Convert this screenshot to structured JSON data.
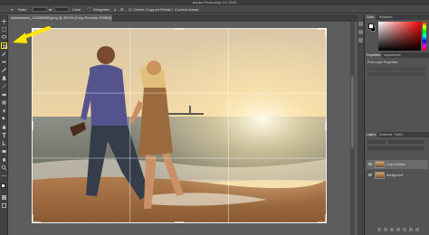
{
  "window": {
    "title": "Adobe Photoshop CC 2018"
  },
  "options_bar": {
    "ratio_label": "Ratio",
    "clear_label": "Clear",
    "straighten_label": "Straighten",
    "delete_cropped_label": "Delete Cropped Pixels",
    "content_aware_label": "Content-Aware"
  },
  "document": {
    "tab_label": "Adobestock_134256659.jpeg @ 33.3% (Crop Preview, RGB/8)"
  },
  "color_panel": {
    "tabs": [
      "Color",
      "Swatches"
    ],
    "foreground": "#ffffff",
    "background": "#000000"
  },
  "properties_panel": {
    "tabs": [
      "Properties",
      "Adjustments"
    ],
    "subtitle": "Pixel Layer Properties"
  },
  "layers_panel": {
    "tabs": [
      "Layers",
      "Channels",
      "Paths"
    ],
    "layers": [
      {
        "name": "Crop Preview",
        "selected": true
      },
      {
        "name": "Background",
        "selected": false
      }
    ]
  },
  "colors": {
    "highlight": "#ffe600",
    "ui_dark": "#424242"
  },
  "tools": [
    "move",
    "crop",
    "eyedropper",
    "brush",
    "stamp",
    "eraser",
    "gradient",
    "blur",
    "dodge",
    "pen",
    "type",
    "path-select",
    "rectangle",
    "hand",
    "zoom"
  ]
}
